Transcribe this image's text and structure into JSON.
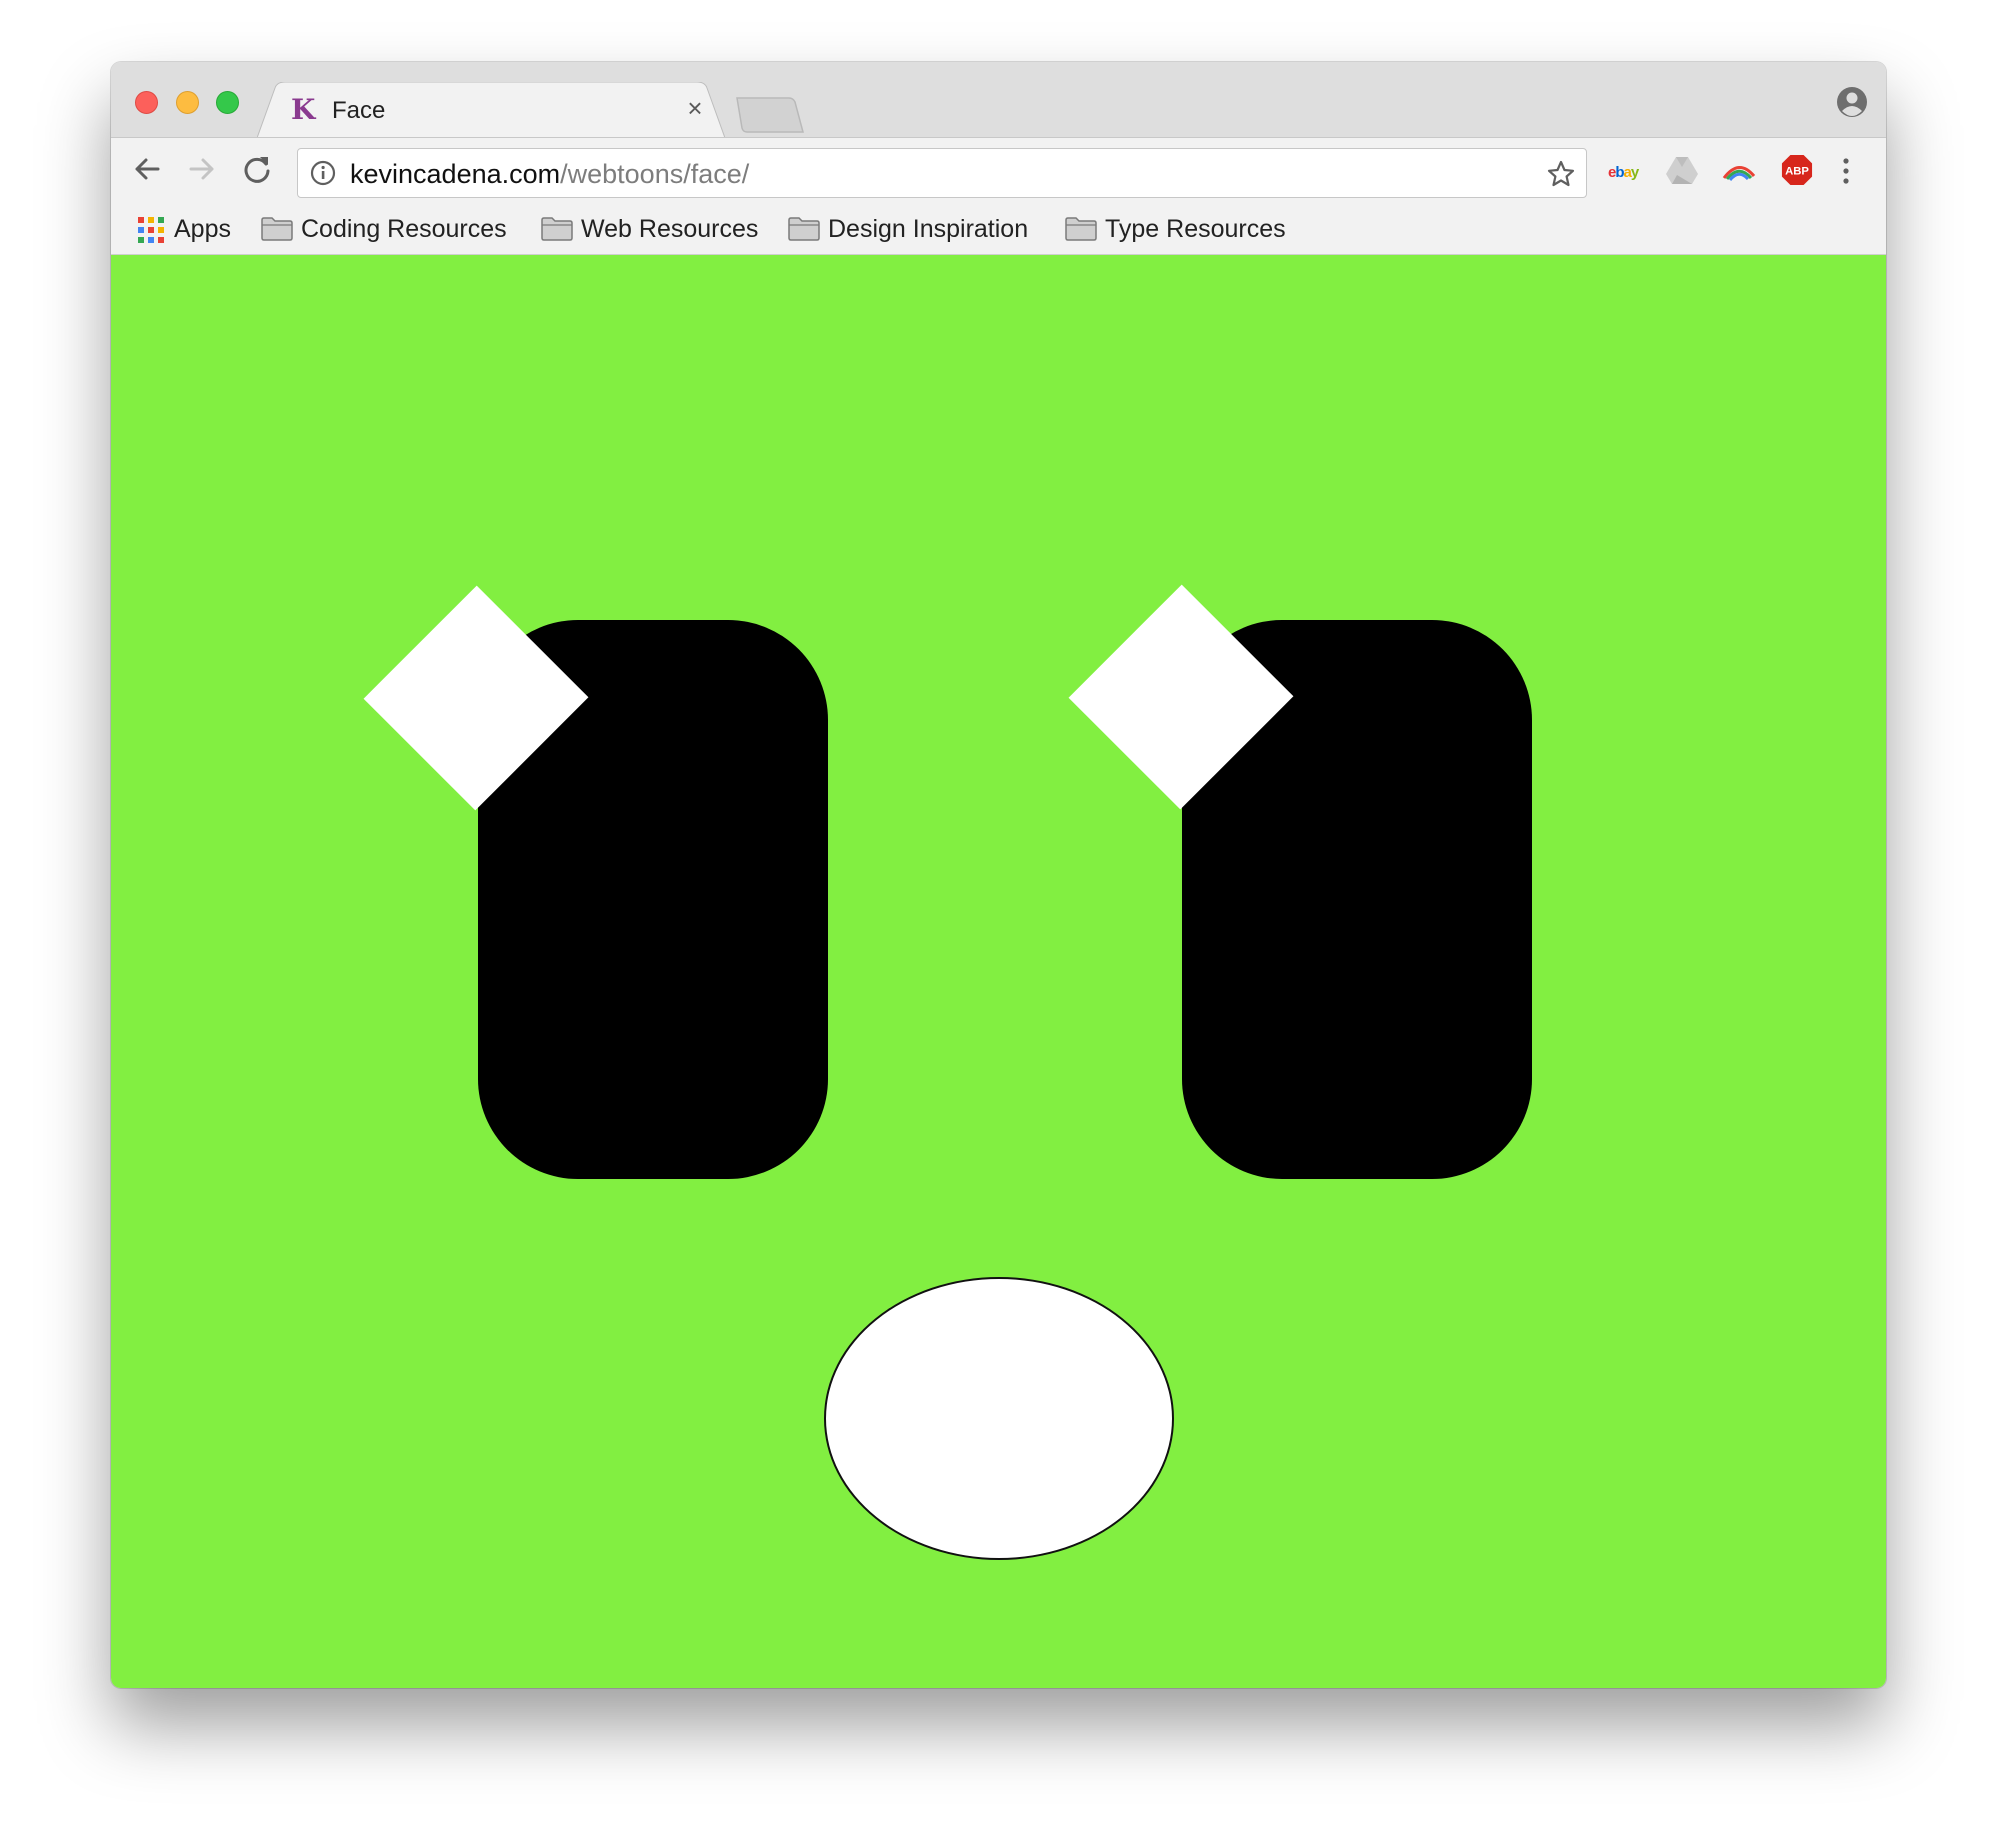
{
  "browser": {
    "tab": {
      "favicon": "K",
      "title": "Face",
      "close_glyph": "×"
    },
    "address": {
      "host": "kevincadena.com",
      "path": "/webtoons/face/"
    },
    "extensions": {
      "ebay": "ebay",
      "adblock": "ABP"
    },
    "bookmarks": [
      {
        "label": "Apps",
        "icon": "apps-grid-icon"
      },
      {
        "label": "Coding Resources",
        "icon": "folder-icon"
      },
      {
        "label": "Web Resources",
        "icon": "folder-icon"
      },
      {
        "label": "Design Inspiration",
        "icon": "folder-icon"
      },
      {
        "label": "Type Resources",
        "icon": "folder-icon"
      }
    ]
  },
  "page": {
    "background_color": "#82ef41",
    "eye_color": "#000000",
    "sparkle_color": "#ffffff",
    "mouth_color": "#ffffff"
  },
  "colors": {
    "traffic_close": "#fc605b",
    "traffic_minimize": "#fdbc40",
    "traffic_maximize": "#34c84a",
    "adblock_red": "#d7261c"
  }
}
